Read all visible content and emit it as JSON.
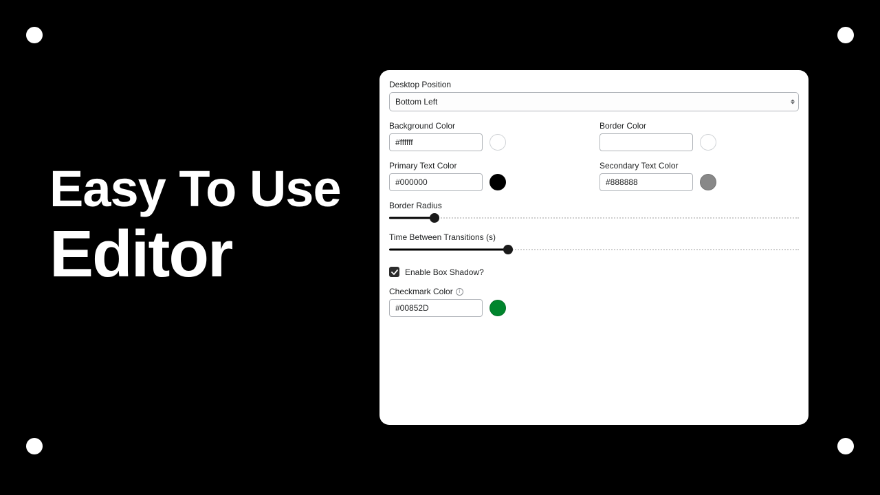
{
  "headline": {
    "line1": "Easy To Use",
    "line2": "Editor"
  },
  "panel": {
    "desktopPosition": {
      "label": "Desktop Position",
      "value": "Bottom Left"
    },
    "backgroundColor": {
      "label": "Background Color",
      "value": "#ffffff",
      "swatch": "#ffffff"
    },
    "borderColor": {
      "label": "Border Color",
      "value": "",
      "swatch": "#ffffff"
    },
    "primaryText": {
      "label": "Primary Text Color",
      "value": "#000000",
      "swatch": "#000000"
    },
    "secondaryText": {
      "label": "Secondary Text Color",
      "value": "#888888",
      "swatch": "#888888"
    },
    "borderRadius": {
      "label": "Border Radius",
      "percent": 11
    },
    "transitionTime": {
      "label": "Time Between Transitions (s)",
      "percent": 29
    },
    "enableShadow": {
      "label": "Enable Box Shadow?",
      "checked": true
    },
    "checkmarkColor": {
      "label": "Checkmark Color",
      "value": "#00852D",
      "swatch": "#00852D"
    }
  }
}
